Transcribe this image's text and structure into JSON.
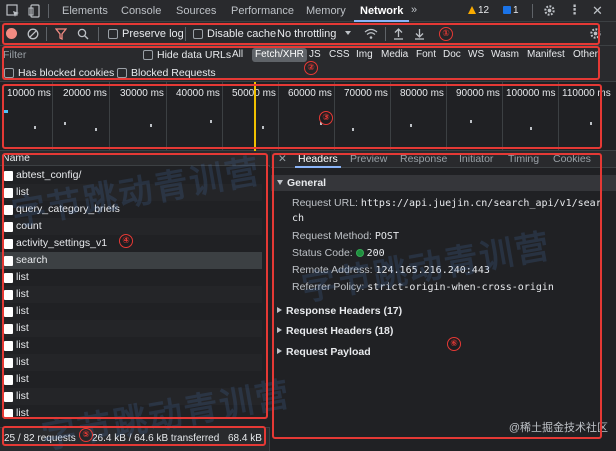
{
  "tabs": [
    "Elements",
    "Console",
    "Sources",
    "Performance",
    "Memory",
    "Network"
  ],
  "active_tab": "Network",
  "badges": {
    "warnings": "12",
    "messages": "1"
  },
  "toolbar": {
    "preserve_log": "Preserve log",
    "disable_cache": "Disable cache",
    "throttling": "No throttling"
  },
  "filter": {
    "placeholder": "Filter",
    "hide_data_urls": "Hide data URLs",
    "types": [
      "All",
      "Fetch/XHR",
      "JS",
      "CSS",
      "Img",
      "Media",
      "Font",
      "Doc",
      "WS",
      "Wasm",
      "Manifest",
      "Other"
    ],
    "selected_type": "Fetch/XHR",
    "has_blocked_cookies": "Has blocked cookies",
    "blocked_requests": "Blocked Requests"
  },
  "timeline": {
    "ticks": [
      "10000 ms",
      "20000 ms",
      "30000 ms",
      "40000 ms",
      "50000 ms",
      "60000 ms",
      "70000 ms",
      "80000 ms",
      "90000 ms",
      "100000 ms",
      "110000 ms"
    ]
  },
  "requests": {
    "column_header": "Name",
    "items": [
      "abtest_config/",
      "list",
      "query_category_briefs",
      "count",
      "activity_settings_v1",
      "search",
      "list",
      "list",
      "list",
      "list",
      "list",
      "list",
      "list",
      "list",
      "list"
    ],
    "selected_index": 5
  },
  "status_bar": {
    "requests": "25 / 82 requests",
    "transferred": "26.4 kB / 64.6 kB transferred",
    "resources": "68.4 kB"
  },
  "detail_tabs": [
    "Headers",
    "Preview",
    "Response",
    "Initiator",
    "Timing",
    "Cookies"
  ],
  "detail_active": "Headers",
  "general": {
    "title": "General",
    "request_url_label": "Request URL:",
    "request_url": "https://api.juejin.cn/search_api/v1/search",
    "request_method_label": "Request Method:",
    "request_method": "POST",
    "status_code_label": "Status Code:",
    "status_code": "200",
    "remote_address_label": "Remote Address:",
    "remote_address": "124.165.216.240:443",
    "referrer_policy_label": "Referrer Policy:",
    "referrer_policy": "strict-origin-when-cross-origin"
  },
  "sections": {
    "response_headers": "Response Headers (17)",
    "request_headers": "Request Headers (18)",
    "request_payload": "Request Payload"
  },
  "annotations": [
    "①",
    "②",
    "③",
    "④",
    "⑤",
    "⑥"
  ],
  "watermark": "字节跳动青训营",
  "footer_mark": "@稀土掘金技术社区",
  "colors": {
    "accent": "#8ab4f8",
    "annotation": "#e53935",
    "marker": "#f0c000",
    "status_ok": "#34a853"
  }
}
